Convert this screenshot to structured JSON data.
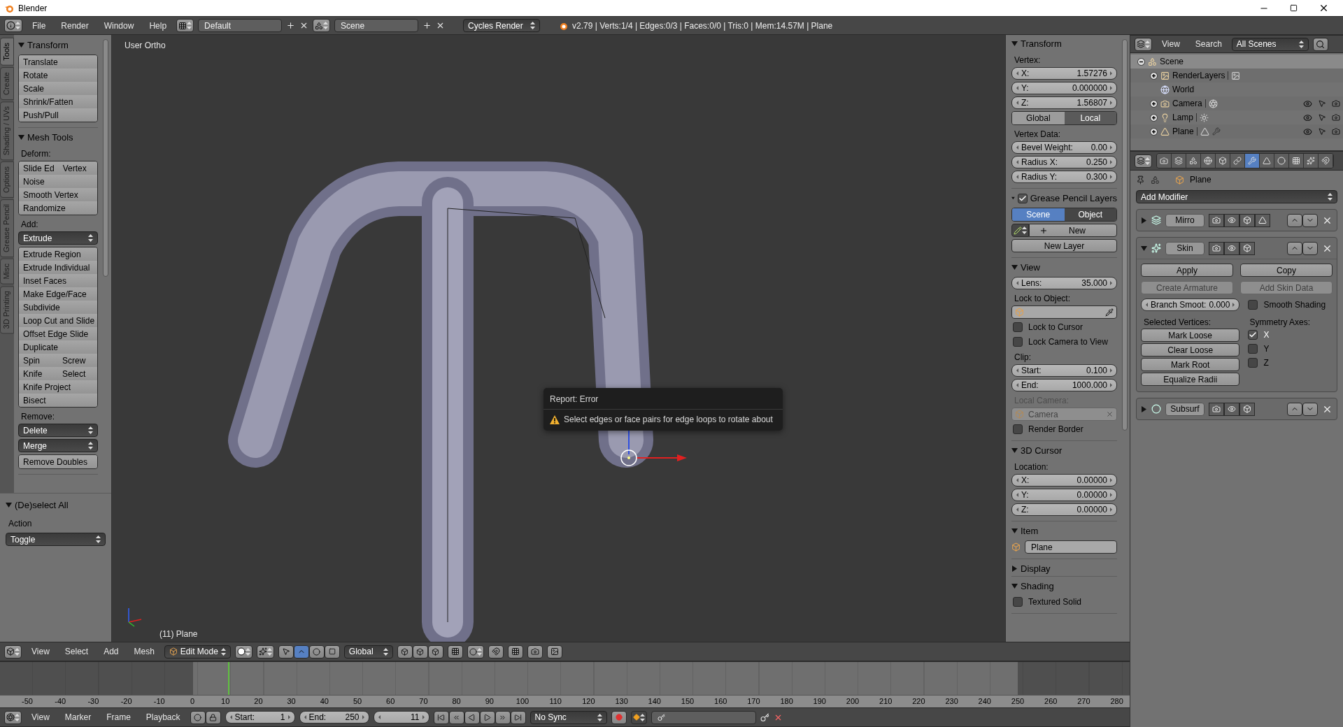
{
  "window": {
    "title": "Blender"
  },
  "top_menu": [
    "File",
    "Render",
    "Window",
    "Help"
  ],
  "layout": "Default",
  "scene": "Scene",
  "engine": "Cycles Render",
  "stats": "v2.79 | Verts:1/4 | Edges:0/3 | Faces:0/0 | Tris:0 | Mem:14.57M | Plane",
  "tool_tabs": [
    {
      "label": "Tools",
      "selected": true
    },
    {
      "label": "Create",
      "selected": false
    },
    {
      "label": "Shading / UVs",
      "selected": false
    },
    {
      "label": "Options",
      "selected": false
    },
    {
      "label": "Grease Pencil",
      "selected": false
    },
    {
      "label": "Misc",
      "selected": false
    },
    {
      "label": "3D Printing",
      "selected": false
    }
  ],
  "tool_panels": [
    {
      "title": "Transform",
      "expanded": true,
      "items": [
        {
          "kind": "group",
          "rows": [
            [
              "Translate"
            ],
            [
              "Rotate"
            ],
            [
              "Scale"
            ],
            [
              "Shrink/Fatten"
            ],
            [
              "Push/Pull"
            ]
          ]
        }
      ]
    },
    {
      "title": "Mesh Tools",
      "expanded": true,
      "items": [
        {
          "kind": "label",
          "text": "Deform:"
        },
        {
          "kind": "group",
          "rows": [
            [
              "Slide Ed",
              "Vertex"
            ],
            [
              "Noise"
            ],
            [
              "Smooth Vertex"
            ],
            [
              "Randomize"
            ]
          ]
        },
        {
          "kind": "label",
          "text": "Add:"
        },
        {
          "kind": "menu",
          "text": "Extrude"
        },
        {
          "kind": "group",
          "rows": [
            [
              "Extrude Region"
            ],
            [
              "Extrude Individual"
            ],
            [
              "Inset Faces"
            ],
            [
              "Make Edge/Face"
            ],
            [
              "Subdivide"
            ],
            [
              "Loop Cut and Slide"
            ],
            [
              "Offset Edge Slide"
            ],
            [
              "Duplicate"
            ],
            [
              "Spin",
              "Screw"
            ],
            [
              "Knife",
              "Select"
            ],
            [
              "Knife Project"
            ],
            [
              "Bisect"
            ]
          ]
        },
        {
          "kind": "label",
          "text": "Remove:"
        },
        {
          "kind": "menu",
          "text": "Delete"
        },
        {
          "kind": "menu",
          "text": "Merge"
        },
        {
          "kind": "group",
          "rows": [
            [
              "Remove Doubles"
            ]
          ]
        }
      ]
    }
  ],
  "operator": {
    "title": "(De)select All",
    "expanded": true,
    "label": "Action",
    "value": "Toggle"
  },
  "viewport": {
    "view_name": "User Ortho",
    "object_label": "(11) Plane",
    "report": {
      "title": "Report: Error",
      "message": "Select edges or face pairs for edge loops to rotate about"
    }
  },
  "n_panels": [
    {
      "title": "Transform",
      "expanded": true,
      "items": [
        {
          "kind": "label",
          "text": "Vertex:"
        },
        {
          "kind": "number",
          "label": "X:",
          "value": "1.57276"
        },
        {
          "kind": "number",
          "label": "Y:",
          "value": "0.000000"
        },
        {
          "kind": "number",
          "label": "Z:",
          "value": "1.56807"
        },
        {
          "kind": "toggles",
          "options": [
            {
              "label": "Global",
              "selected": false
            },
            {
              "label": "Local",
              "selected": true
            }
          ]
        },
        {
          "kind": "label",
          "text": "Vertex Data:"
        },
        {
          "kind": "number",
          "label": "Bevel Weight:",
          "value": "0.00"
        },
        {
          "kind": "number",
          "label": "Radius X:",
          "value": "0.250"
        },
        {
          "kind": "number",
          "label": "Radius Y:",
          "value": "0.300"
        }
      ]
    },
    {
      "title": "Grease Pencil Layers",
      "enabled": true,
      "expanded": true,
      "items": [
        {
          "kind": "radio",
          "options": [
            {
              "label": "Scene",
              "selected": true
            },
            {
              "label": "Object",
              "selected": false
            }
          ]
        },
        {
          "kind": "new",
          "text": "New"
        },
        {
          "kind": "button",
          "text": "New Layer"
        }
      ]
    },
    {
      "title": "View",
      "expanded": true,
      "items": [
        {
          "kind": "number",
          "label": "Lens:",
          "value": "35.000"
        },
        {
          "kind": "label",
          "text": "Lock to Object:"
        },
        {
          "kind": "object"
        },
        {
          "kind": "check",
          "text": "Lock to Cursor",
          "checked": false
        },
        {
          "kind": "check",
          "text": "Lock Camera to View",
          "checked": false
        },
        {
          "kind": "label",
          "text": "Clip:"
        },
        {
          "kind": "number",
          "label": "Start:",
          "value": "0.100"
        },
        {
          "kind": "number",
          "label": "End:",
          "value": "1000.000"
        },
        {
          "kind": "label",
          "text": "Local Camera:",
          "disabled": true
        },
        {
          "kind": "object",
          "text": "Camera",
          "disabled": true
        },
        {
          "kind": "check",
          "text": "Render Border",
          "checked": false
        }
      ]
    },
    {
      "title": "3D Cursor",
      "expanded": true,
      "items": [
        {
          "kind": "label",
          "text": "Location:"
        },
        {
          "kind": "number",
          "label": "X:",
          "value": "0.00000"
        },
        {
          "kind": "number",
          "label": "Y:",
          "value": "0.00000"
        },
        {
          "kind": "number",
          "label": "Z:",
          "value": "0.00000"
        }
      ]
    },
    {
      "title": "Item",
      "expanded": true,
      "items": [
        {
          "kind": "name",
          "text": "Plane"
        }
      ]
    },
    {
      "title": "Display",
      "expanded": false
    },
    {
      "title": "Shading",
      "expanded": true,
      "items": [
        {
          "kind": "check",
          "text": "Textured Solid",
          "checked": false
        }
      ]
    }
  ],
  "outliner": {
    "menus": [
      "View",
      "Search"
    ],
    "filter": "All Scenes",
    "tree": [
      {
        "label": "Scene",
        "kind": "scene",
        "expanded": true,
        "selected": true,
        "children": [
          {
            "label": "RenderLayers",
            "kind": "renderlayers",
            "expanded": false,
            "selected": false
          },
          {
            "label": "World",
            "kind": "world",
            "selected": false
          },
          {
            "label": "Camera",
            "kind": "camera",
            "expanded": false,
            "selected": false
          },
          {
            "label": "Lamp",
            "kind": "lamp",
            "expanded": false,
            "selected": false
          },
          {
            "label": "Plane",
            "kind": "mesh",
            "expanded": false,
            "selected": false
          }
        ]
      }
    ]
  },
  "properties": {
    "tabs": [
      {
        "selected": false
      },
      {
        "selected": false
      },
      {
        "selected": false
      },
      {
        "selected": false
      },
      {
        "selected": false
      },
      {
        "selected": false
      },
      {
        "selected": true
      },
      {
        "selected": false
      },
      {
        "selected": false
      },
      {
        "selected": false
      },
      {
        "selected": false
      },
      {
        "selected": false
      }
    ],
    "context": "Plane",
    "add_modifier": "Add Modifier",
    "modifiers": [
      {
        "name": "Mirro",
        "kind": "mirror",
        "expanded": false
      },
      {
        "name": "Skin",
        "kind": "skin",
        "expanded": true,
        "actions": [
          "Apply",
          "Copy"
        ],
        "disabled_actions": [
          "Create Armature",
          "Add Skin Data"
        ],
        "branch": {
          "label": "Branch Smoot:",
          "value": "0.000"
        },
        "smooth_shading": {
          "label": "Smooth Shading",
          "checked": false
        },
        "vertices_label": "Selected Vertices:",
        "vertex_buttons": [
          "Mark Loose",
          "Clear Loose",
          "Mark Root",
          "Equalize Radii"
        ],
        "axes_label": "Symmetry Axes:",
        "axes": [
          {
            "label": "X",
            "checked": true
          },
          {
            "label": "Y",
            "checked": false
          },
          {
            "label": "Z",
            "checked": false
          }
        ]
      },
      {
        "name": "Subsurf",
        "kind": "subsurf",
        "expanded": false
      }
    ]
  },
  "view_header": {
    "menus": [
      "View",
      "Select",
      "Add",
      "Mesh"
    ],
    "mode": "Edit Mode",
    "orientation": "Global"
  },
  "timeline": {
    "ruler": [
      "-50",
      "-40",
      "-30",
      "-20",
      "-10",
      "0",
      "10",
      "20",
      "30",
      "40",
      "50",
      "60",
      "70",
      "80",
      "90",
      "100",
      "110",
      "120",
      "130",
      "140",
      "150",
      "160",
      "170",
      "180",
      "190",
      "200",
      "210",
      "220",
      "230",
      "240",
      "250",
      "260",
      "270",
      "280"
    ],
    "menus": [
      "View",
      "Marker",
      "Frame",
      "Playback"
    ],
    "start": {
      "label": "Start:",
      "value": "1"
    },
    "end": {
      "label": "End:",
      "value": "250"
    },
    "current": "11",
    "sync": "No Sync"
  }
}
